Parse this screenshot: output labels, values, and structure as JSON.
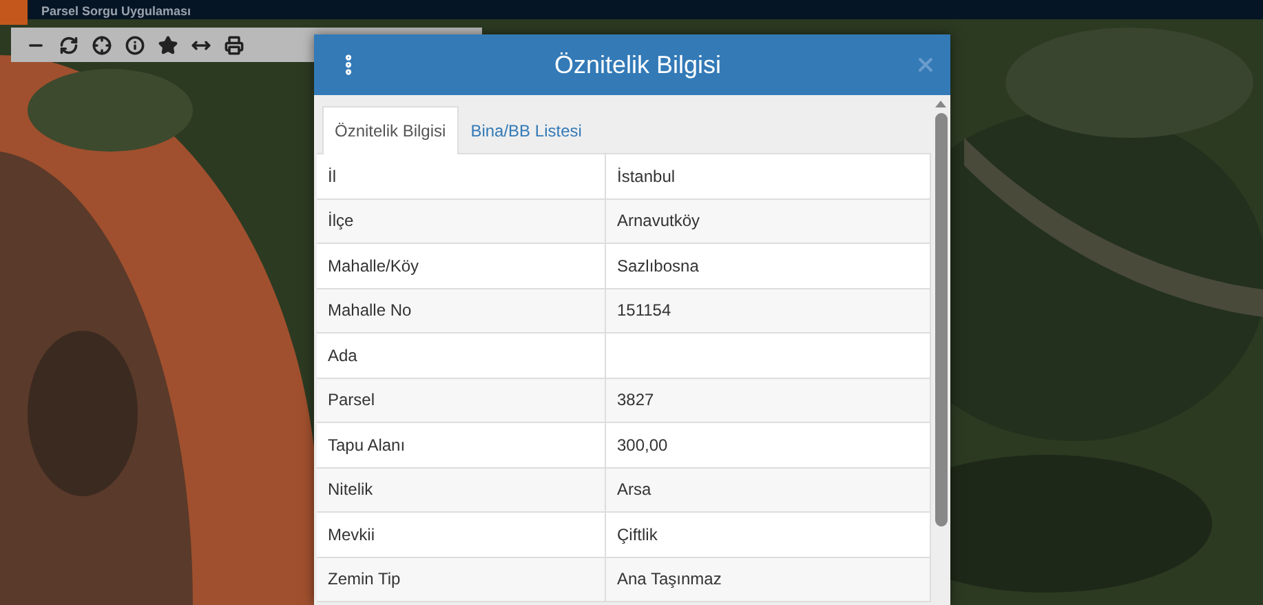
{
  "app_header": {
    "title": "Parsel Sorgu Uygulaması"
  },
  "toolbar": {
    "tools": [
      {
        "kind": "minus"
      },
      {
        "kind": "refresh"
      },
      {
        "kind": "locate"
      },
      {
        "kind": "info"
      },
      {
        "kind": "star"
      },
      {
        "kind": "measure"
      },
      {
        "kind": "print"
      }
    ]
  },
  "dialog": {
    "title": "Öznitelik Bilgisi",
    "tabs": [
      {
        "label": "Öznitelik Bilgisi",
        "selected": true
      },
      {
        "label": "Bina/BB Listesi",
        "selected": false
      }
    ],
    "rows": [
      {
        "field": "İl",
        "value": "İstanbul"
      },
      {
        "field": "İlçe",
        "value": "Arnavutköy"
      },
      {
        "field": "Mahalle/Köy",
        "value": "Sazlıbosna"
      },
      {
        "field": "Mahalle No",
        "value": "151154"
      },
      {
        "field": "Ada"
      },
      {
        "field": "Parsel",
        "value": "3827"
      },
      {
        "field": "Tapu Alanı",
        "value": "300,00"
      },
      {
        "field": "Nitelik",
        "value": "Arsa"
      },
      {
        "field": "Mevkii",
        "value": "Çiftlik"
      },
      {
        "field": "Zemin Tip",
        "value": "Ana Taşınmaz"
      }
    ]
  }
}
